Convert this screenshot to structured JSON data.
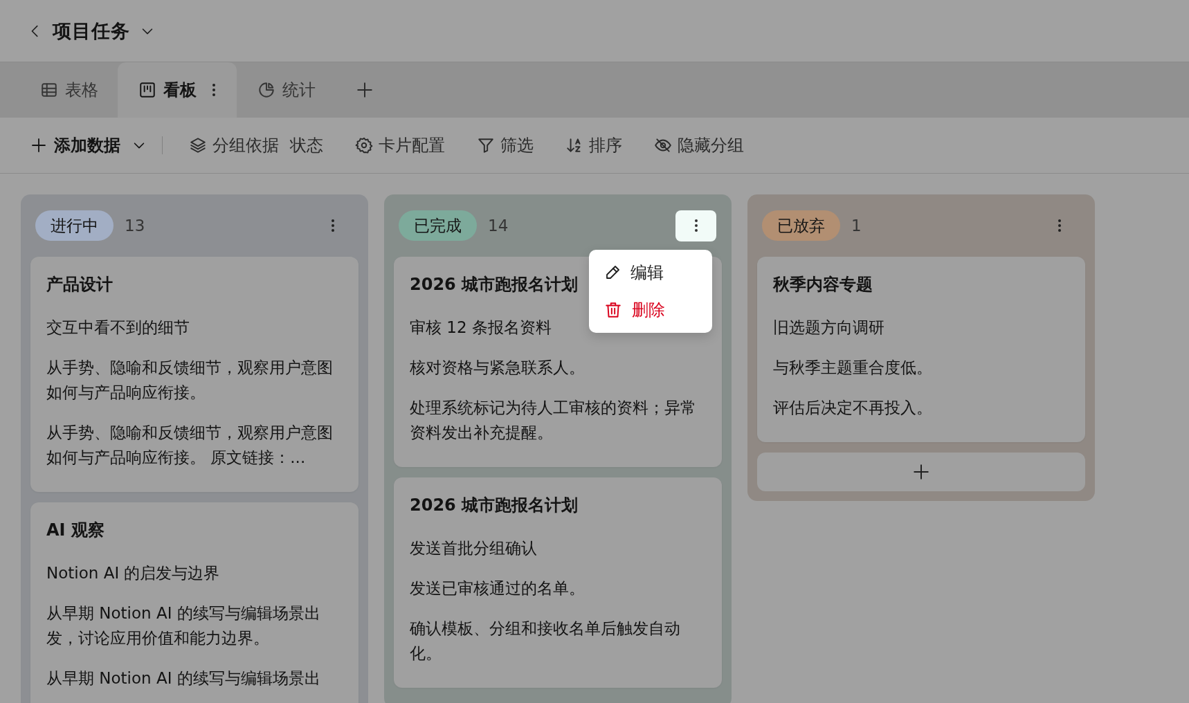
{
  "header": {
    "title": "项目任务"
  },
  "tabs": [
    {
      "label": "表格",
      "kind": "table",
      "selected": false
    },
    {
      "label": "看板",
      "kind": "kanban",
      "selected": true
    },
    {
      "label": "统计",
      "kind": "pie",
      "selected": false
    }
  ],
  "toolbar": [
    {
      "kind": "add",
      "label": "添加数据"
    },
    {
      "kind": "group",
      "label": "分组依据",
      "value": "状态"
    },
    {
      "kind": "card",
      "label": "卡片配置"
    },
    {
      "kind": "filter",
      "label": "筛选"
    },
    {
      "kind": "sort",
      "label": "排序"
    },
    {
      "kind": "hide",
      "label": "隐藏分组"
    }
  ],
  "columns": [
    {
      "name": "进行中",
      "count": "13",
      "color": "#a2aec4",
      "menu_open": false,
      "add_card": false,
      "cards": [
        {
          "title": "产品设计",
          "lines": [
            "交互中看不到的细节",
            "从手势、隐喻和反馈细节，观察用户意图如何与产品响应衔接。",
            "从手势、隐喻和反馈细节，观察用户意图如何与产品响应衔接。 原文链接：..."
          ]
        },
        {
          "title": "AI 观察",
          "lines": [
            "Notion AI 的启发与边界",
            "从早期 Notion AI 的续写与编辑场景出发，讨论应用价值和能力边界。",
            "从早期 Notion AI 的续写与编辑场景出"
          ]
        }
      ]
    },
    {
      "name": "已完成",
      "count": "14",
      "color": "#7daa9b",
      "menu_open": true,
      "add_card": false,
      "cards": [
        {
          "title": "2026 城市跑报名计划",
          "lines": [
            "审核 12 条报名资料",
            "核对资格与紧急联系人。",
            "处理系统标记为待人工审核的资料；异常资料发出补充提醒。"
          ]
        },
        {
          "title": "2026 城市跑报名计划",
          "lines": [
            "发送首批分组确认",
            "发送已审核通过的名单。",
            "确认模板、分组和接收名单后触发自动化。"
          ]
        }
      ]
    },
    {
      "name": "已放弃",
      "count": "1",
      "color": "#b28f72",
      "menu_open": false,
      "add_card": true,
      "cards": [
        {
          "title": "秋季内容专题",
          "lines": [
            "旧选题方向调研",
            "与秋季主题重合度低。",
            "评估后决定不再投入。"
          ]
        }
      ]
    }
  ],
  "context_menu": {
    "items": [
      {
        "kind": "edit",
        "label": "编辑"
      },
      {
        "kind": "delete",
        "label": "删除"
      }
    ]
  }
}
